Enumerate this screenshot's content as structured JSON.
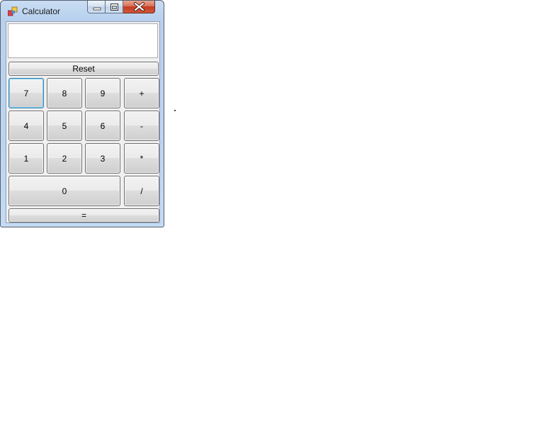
{
  "window": {
    "title": "Calculator"
  },
  "display": {
    "value": ""
  },
  "buttons": {
    "reset": "Reset",
    "seven": "7",
    "eight": "8",
    "nine": "9",
    "plus": "+",
    "four": "4",
    "five": "5",
    "six": "6",
    "minus": "-",
    "one": "1",
    "two": "2",
    "three": "3",
    "multiply": "*",
    "zero": "0",
    "divide": "/",
    "equals": "="
  },
  "colors": {
    "close_button": "#c23c22",
    "frame": "#bcd4ee",
    "focus": "#3c7fb1"
  }
}
